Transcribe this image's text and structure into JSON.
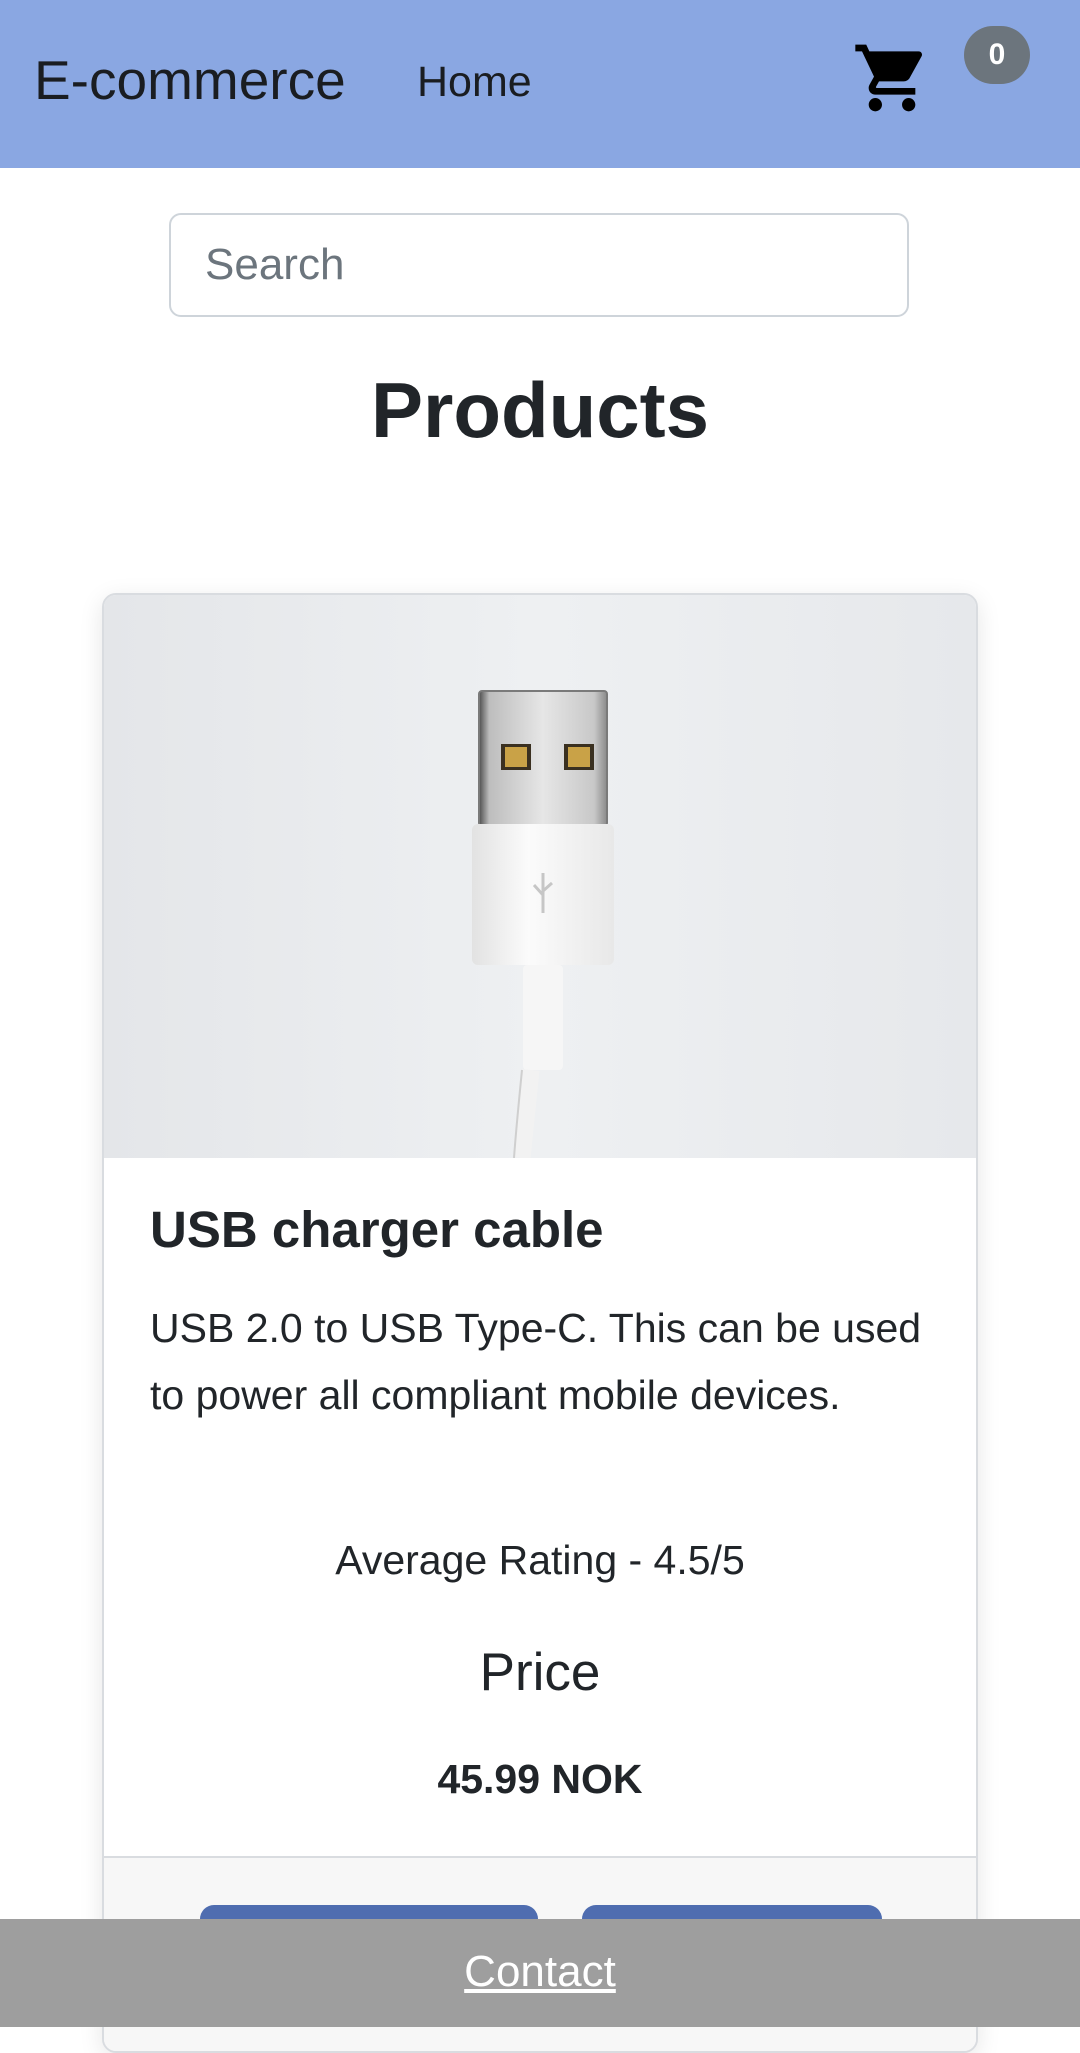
{
  "navbar": {
    "brand": "E-commerce",
    "home_label": "Home",
    "cart_count": "0"
  },
  "search": {
    "placeholder": "Search",
    "value": ""
  },
  "main": {
    "title": "Products"
  },
  "products": [
    {
      "name": "USB charger cable",
      "description": "USB 2.0 to USB Type-C. This can be used to power all compliant mobile devices.",
      "rating_text": "Average Rating - 4.5/5",
      "price_heading": "Price",
      "price": "45.99 NOK",
      "image_icon": "usb-cable-photo"
    }
  ],
  "footer": {
    "contact_label": "Contact"
  },
  "colors": {
    "navbar_bg": "#8aa7e2",
    "badge_bg": "#6c757d",
    "button_bg": "#4f6db0",
    "footer_bg": "#9e9e9e"
  }
}
